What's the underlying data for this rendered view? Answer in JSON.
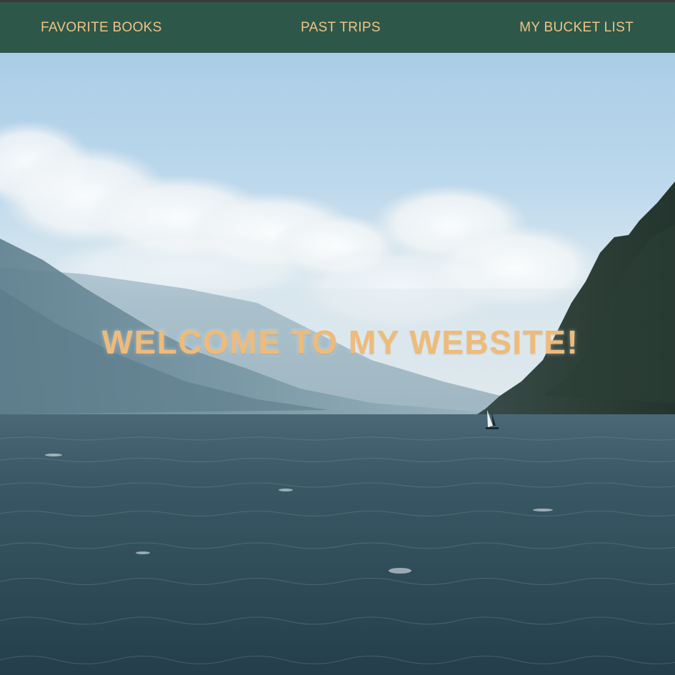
{
  "nav": {
    "items": [
      {
        "label": "FAVORITE BOOKS"
      },
      {
        "label": "PAST TRIPS"
      },
      {
        "label": "MY BUCKET LIST"
      }
    ]
  },
  "hero": {
    "title": "WELCOME TO MY WEBSITE!",
    "image": "lake-mountains-windsurfer"
  },
  "colors": {
    "navbar_bg": "#2d5849",
    "nav_text": "#f0c387",
    "title_text": "#eebb7a"
  }
}
